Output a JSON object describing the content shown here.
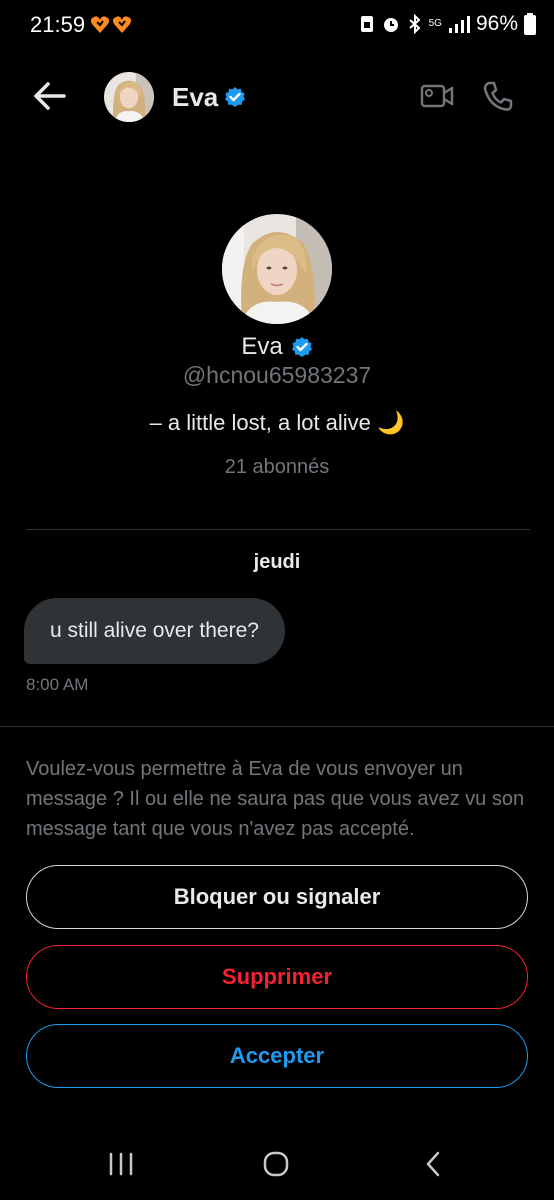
{
  "status_bar": {
    "time": "21:59",
    "battery": "96%",
    "network": "5G"
  },
  "header": {
    "name": "Eva",
    "verified": true
  },
  "profile": {
    "name": "Eva",
    "handle": "@hcnou65983237",
    "bio": "– a little lost, a lot alive 🌙",
    "followers": "21 abonnés"
  },
  "conversation": {
    "day_label": "jeudi",
    "messages": [
      {
        "text": "u still alive over there?",
        "time": "8:00 AM"
      }
    ]
  },
  "request": {
    "text": "Voulez-vous permettre à Eva de vous envoyer un message ? Il ou elle ne saura pas que vous avez vu son message tant que vous n'avez pas accepté.",
    "block_label": "Bloquer ou signaler",
    "delete_label": "Supprimer",
    "accept_label": "Accepter"
  },
  "colors": {
    "accent": "#1d9bf0",
    "danger": "#f4212e",
    "muted": "#71767b",
    "bubble": "#2f3336",
    "background": "#000000"
  },
  "icons": {
    "back": "arrow-left-icon",
    "video": "video-camera-icon",
    "phone": "phone-icon",
    "verified": "verified-badge-icon",
    "nav_recent": "recent-apps-icon",
    "nav_home": "home-icon",
    "nav_back": "nav-back-icon"
  }
}
